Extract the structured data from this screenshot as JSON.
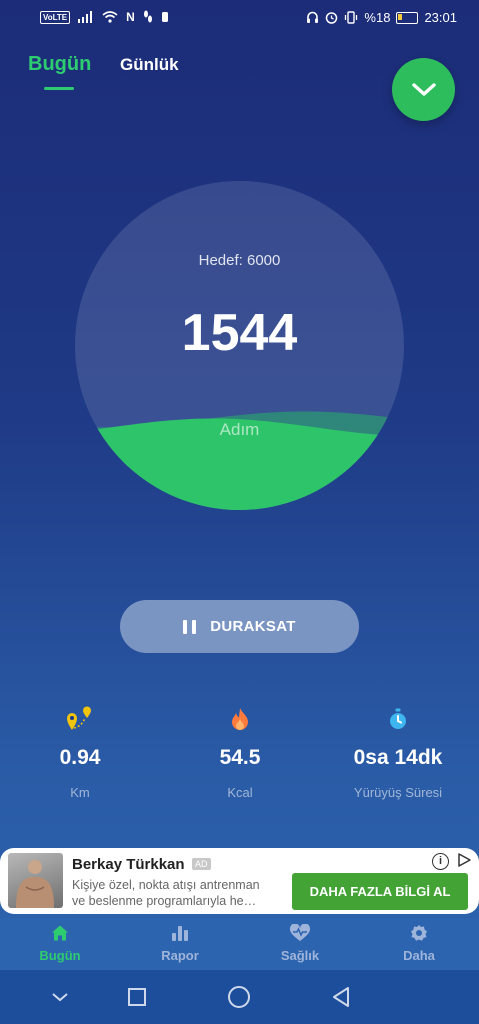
{
  "status_bar": {
    "volte": "VoLTE",
    "n_label": "N",
    "battery_percent": "%18",
    "time": "23:01"
  },
  "header": {
    "tab_today": "Bugün",
    "tab_daily": "Günlük",
    "fab_icon": "chevron-down-icon"
  },
  "progress": {
    "goal_text": "Hedef: 6000",
    "steps": "1544",
    "unit": "Adım",
    "fill_fraction": 0.257
  },
  "pause_button": {
    "label": "DURAKSAT",
    "icon": "pause-icon"
  },
  "stats": [
    {
      "icon": "location-route-icon",
      "value": "0.94",
      "label": "Km",
      "color": "#f1c40f"
    },
    {
      "icon": "flame-icon",
      "value": "54.5",
      "label": "Kcal",
      "color": "#ff7a3d"
    },
    {
      "icon": "stopwatch-icon",
      "value": "0sa 14dk",
      "label": "Yürüyüş Süresi",
      "color": "#3fb5ef"
    }
  ],
  "ad": {
    "title": "Berkay Türkkan",
    "badge": "AD",
    "line1": "Kişiye özel, nokta atışı antrenman",
    "line2": "ve beslenme programlarıyla he…",
    "cta": "DAHA FAZLA BİLGİ AL"
  },
  "bottom_nav": [
    {
      "icon": "home-icon",
      "label": "Bugün",
      "active": true
    },
    {
      "icon": "bar-chart-icon",
      "label": "Rapor",
      "active": false
    },
    {
      "icon": "heart-pulse-icon",
      "label": "Sağlık",
      "active": false
    },
    {
      "icon": "gear-icon",
      "label": "Daha",
      "active": false
    }
  ],
  "colors": {
    "accent_green": "#2ecc71",
    "background_top": "#1c2c78",
    "background_bottom": "#2d66b0",
    "cta_green": "#43a435"
  }
}
